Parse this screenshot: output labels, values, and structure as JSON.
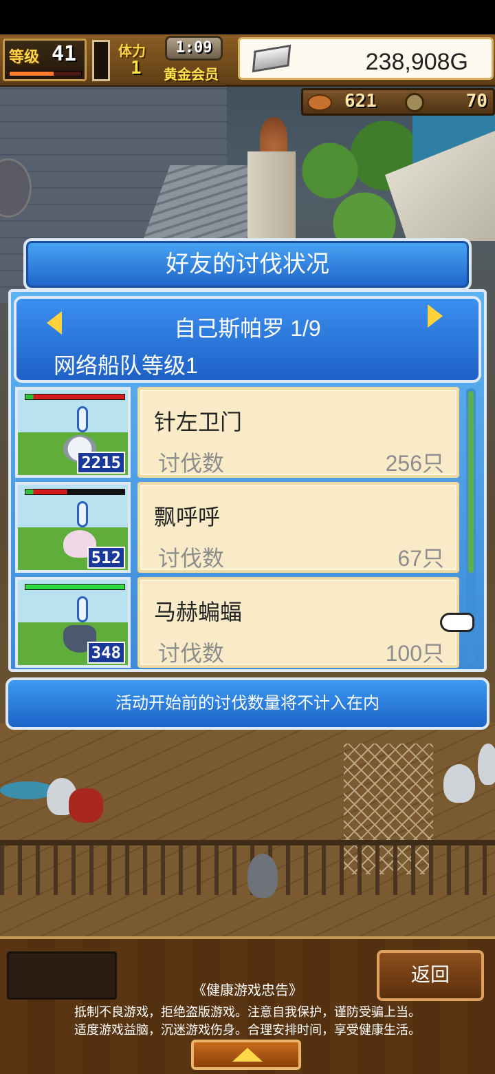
{
  "hud": {
    "level_label": "等级",
    "level_value": "41",
    "level_progress": 0.62,
    "stamina_label": "体力",
    "stamina_value": "1",
    "clock": "1:09",
    "member": "黄金会员",
    "gold": "238,908G",
    "meat": "621",
    "coins": "70"
  },
  "dialog": {
    "title": "好友的讨伐状况",
    "friend_name": "自己斯帕罗 1/9",
    "fleet_level": "网络船队等级1",
    "kill_label": "讨伐数",
    "notice": "活动开始前的讨伐数量将不计入在内"
  },
  "monsters": [
    {
      "name": "针左卫门",
      "badge": "2215",
      "kills": "256只",
      "hp": 0.92
    },
    {
      "name": "飘呼呼",
      "badge": "512",
      "kills": "67只",
      "hp": 0.92
    },
    {
      "name": "马赫蝙蝠",
      "badge": "348",
      "kills": "100只",
      "hp": 1.0
    }
  ],
  "footer": {
    "back_label": "返回",
    "advice_title": "《健康游戏忠告》",
    "advice_line1": "抵制不良游戏，拒绝盗版游戏。注意自我保护，谨防受骗上当。",
    "advice_line2": "适度游戏益脑，沉迷游戏伤身。合理安排时间，享受健康生活。"
  }
}
